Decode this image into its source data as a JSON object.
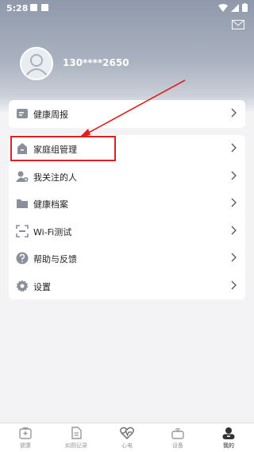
{
  "status": {
    "time": "5:28"
  },
  "profile": {
    "username": "130****2650"
  },
  "menu": {
    "top": [
      {
        "label": "健康周报",
        "icon": "report-icon"
      }
    ],
    "main": [
      {
        "label": "家庭组管理",
        "icon": "home-group-icon"
      },
      {
        "label": "我关注的人",
        "icon": "followed-people-icon"
      },
      {
        "label": "健康档案",
        "icon": "folder-icon"
      },
      {
        "label": "Wi-Fi测试",
        "icon": "scan-icon"
      },
      {
        "label": "帮助与反馈",
        "icon": "help-icon"
      },
      {
        "label": "设置",
        "icon": "gear-icon"
      }
    ]
  },
  "tabs": [
    {
      "label": "健康",
      "icon": "health-icon"
    },
    {
      "label": "如厕记录",
      "icon": "record-icon"
    },
    {
      "label": "心电",
      "icon": "ecg-icon"
    },
    {
      "label": "设备",
      "icon": "device-icon"
    },
    {
      "label": "我的",
      "icon": "profile-icon",
      "active": true
    }
  ],
  "colors": {
    "accent_red": "#e02020",
    "header_top": "#8f99ab",
    "icon_gray": "#8a8f99"
  }
}
